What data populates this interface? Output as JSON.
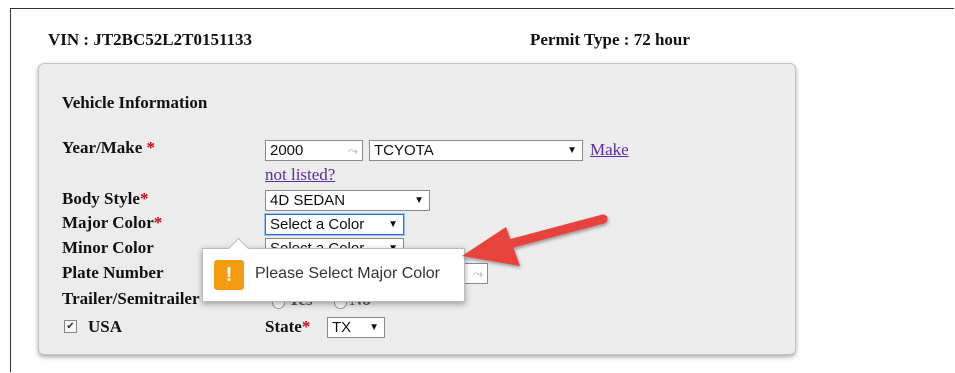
{
  "header": {
    "vin": "VIN : JT2BC52L2T0151133",
    "permit": "Permit Type : 72 hour"
  },
  "panel": {
    "title": "Vehicle Information",
    "year_make_label": "Year/Make",
    "year_value": "2000",
    "make_value": "TCYOTA",
    "make_link_1": "Make",
    "make_link_2": "not listed?",
    "body_style_label": "Body Style",
    "body_style_value": "4D SEDAN",
    "major_color_label": "Major Color",
    "major_color_value": "Select a Color",
    "minor_color_label": "Minor Color",
    "minor_color_value": "Select a Color",
    "plate_label": "Plate Number",
    "trailer_label": "Trailer/Semitrailer",
    "trailer_yes": "Yes",
    "trailer_no": "No",
    "usa_label": "USA",
    "state_label": "State",
    "state_value": "TX",
    "required_mark": "*"
  },
  "tooltip": {
    "message": "Please Select Major Color",
    "icon": "warning-icon",
    "icon_glyph": "!"
  },
  "colors": {
    "required": "#d0021b",
    "warning": "#f39c12",
    "arrow": "#e8423c",
    "link": "#5b2d9e"
  }
}
